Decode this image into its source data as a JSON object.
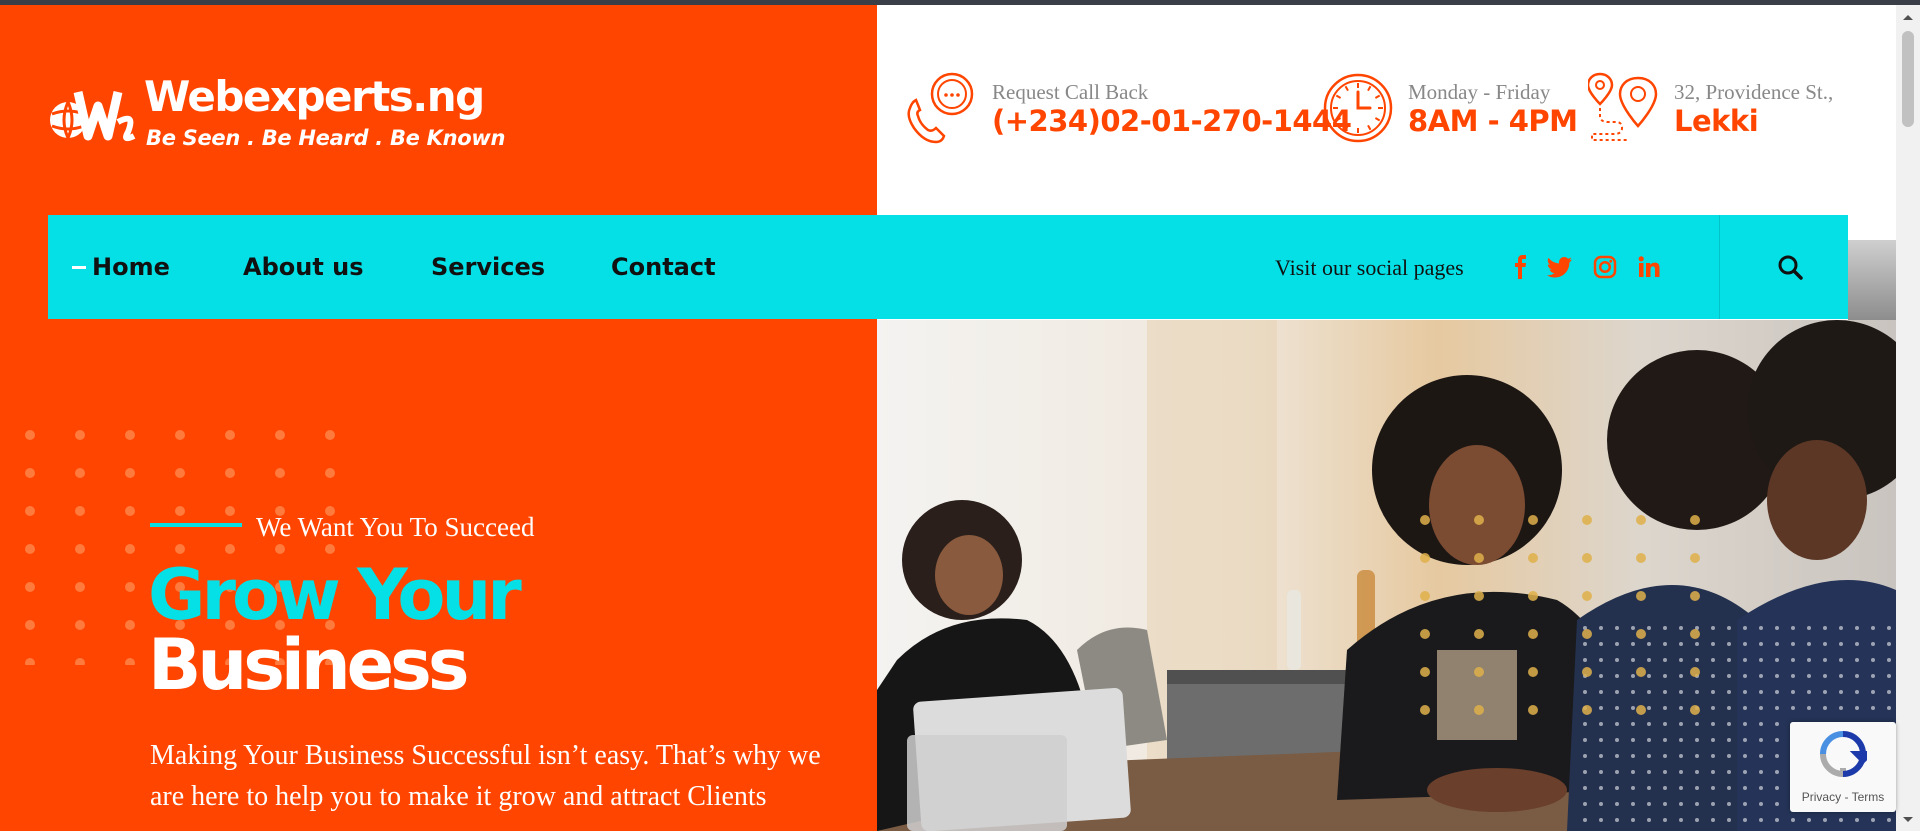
{
  "brand": {
    "name": "Webexperts.ng",
    "tagline": "Be Seen . Be Heard . Be Known"
  },
  "contact": [
    {
      "icon": "phone-chat-icon",
      "label": "Request Call Back",
      "value": "(+234)02-01-270-1444"
    },
    {
      "icon": "clock-icon",
      "label": "Monday - Friday",
      "value": "8AM - 4PM"
    },
    {
      "icon": "location-pin-icon",
      "label": "32, Providence St.,",
      "value": "Lekki"
    }
  ],
  "nav": {
    "items": [
      "Home",
      "About us",
      "Services",
      "Contact"
    ],
    "active_index": 0,
    "social_label": "Visit our social pages",
    "socials": [
      "facebook-icon",
      "twitter-icon",
      "instagram-icon",
      "linkedin-icon"
    ]
  },
  "hero": {
    "eyebrow": "We Want You To Succeed",
    "headline_line1": "Grow Your",
    "headline_line2": "Business",
    "text": "Making Your Business Successful isn’t easy. That’s why we are here to help you to make it grow and attract Clients"
  },
  "recaptcha": {
    "privacy": "Privacy",
    "terms": "Terms",
    "separator": " - "
  },
  "colors": {
    "brand_orange": "#ff4500",
    "nav_cyan": "#05e0e6",
    "text_dark": "#111111",
    "muted_gray": "#888888"
  }
}
